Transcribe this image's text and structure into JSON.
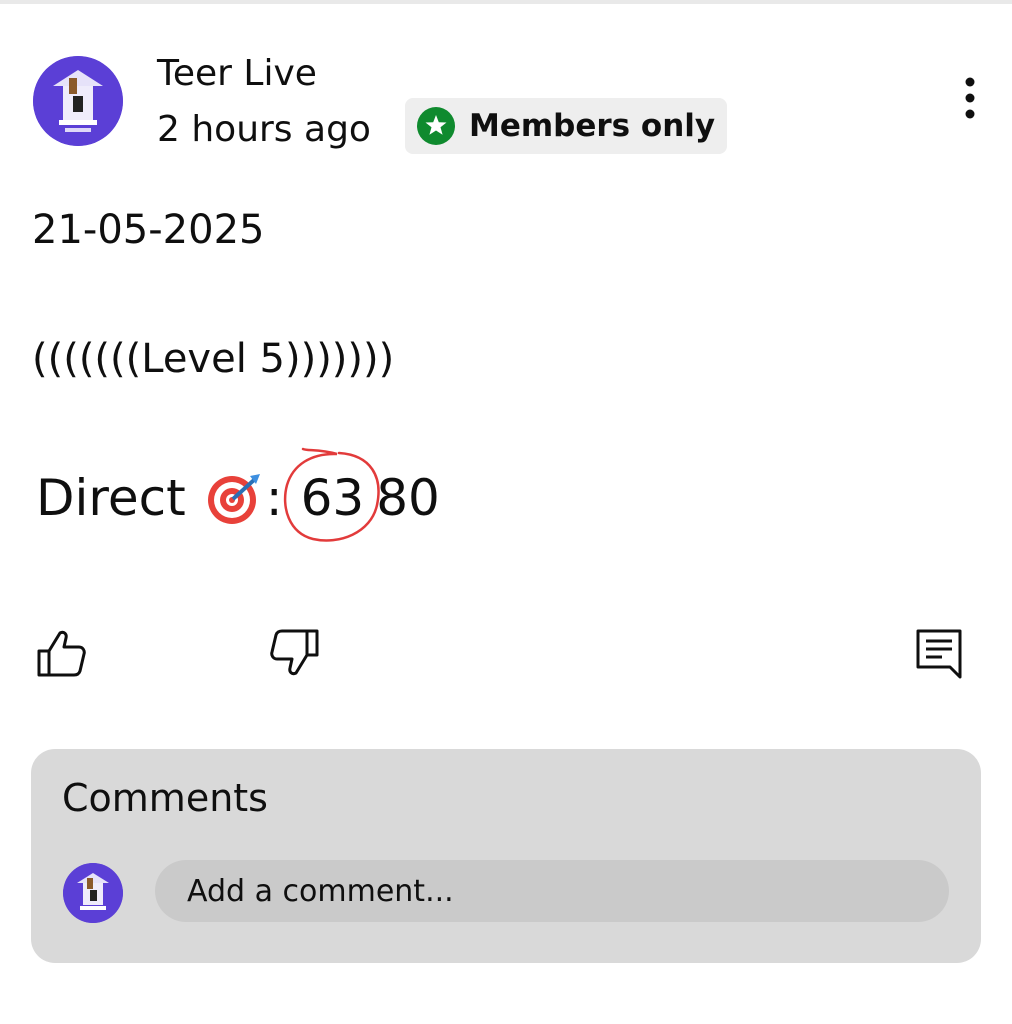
{
  "post": {
    "channel_name": "Teer Live",
    "time_ago": "2 hours ago",
    "badge": {
      "label": "Members only",
      "icon": "star-badge-icon",
      "color": "#0f8a2e"
    },
    "avatar_caption": "TEER LIVE",
    "date_line": "21-05-2025",
    "level_line": "(((((((Level 5)))))))",
    "direct": {
      "label": "Direct",
      "emoji_icon": "direct-hit-target-icon",
      "separator": ":",
      "circled_number": "63",
      "second_number": "80",
      "circle_color": "#e23b3b"
    }
  },
  "actions": {
    "like": "thumbs-up-icon",
    "dislike": "thumbs-down-icon",
    "comment": "comment-icon",
    "more": "more-vertical-icon"
  },
  "comments": {
    "title": "Comments",
    "input_placeholder": "Add a comment..."
  },
  "colors": {
    "avatar_bg": "#5b3fd6",
    "badge_bg": "#eeeeee",
    "comments_bg": "#d9d9d9",
    "input_bg": "#cacaca"
  }
}
